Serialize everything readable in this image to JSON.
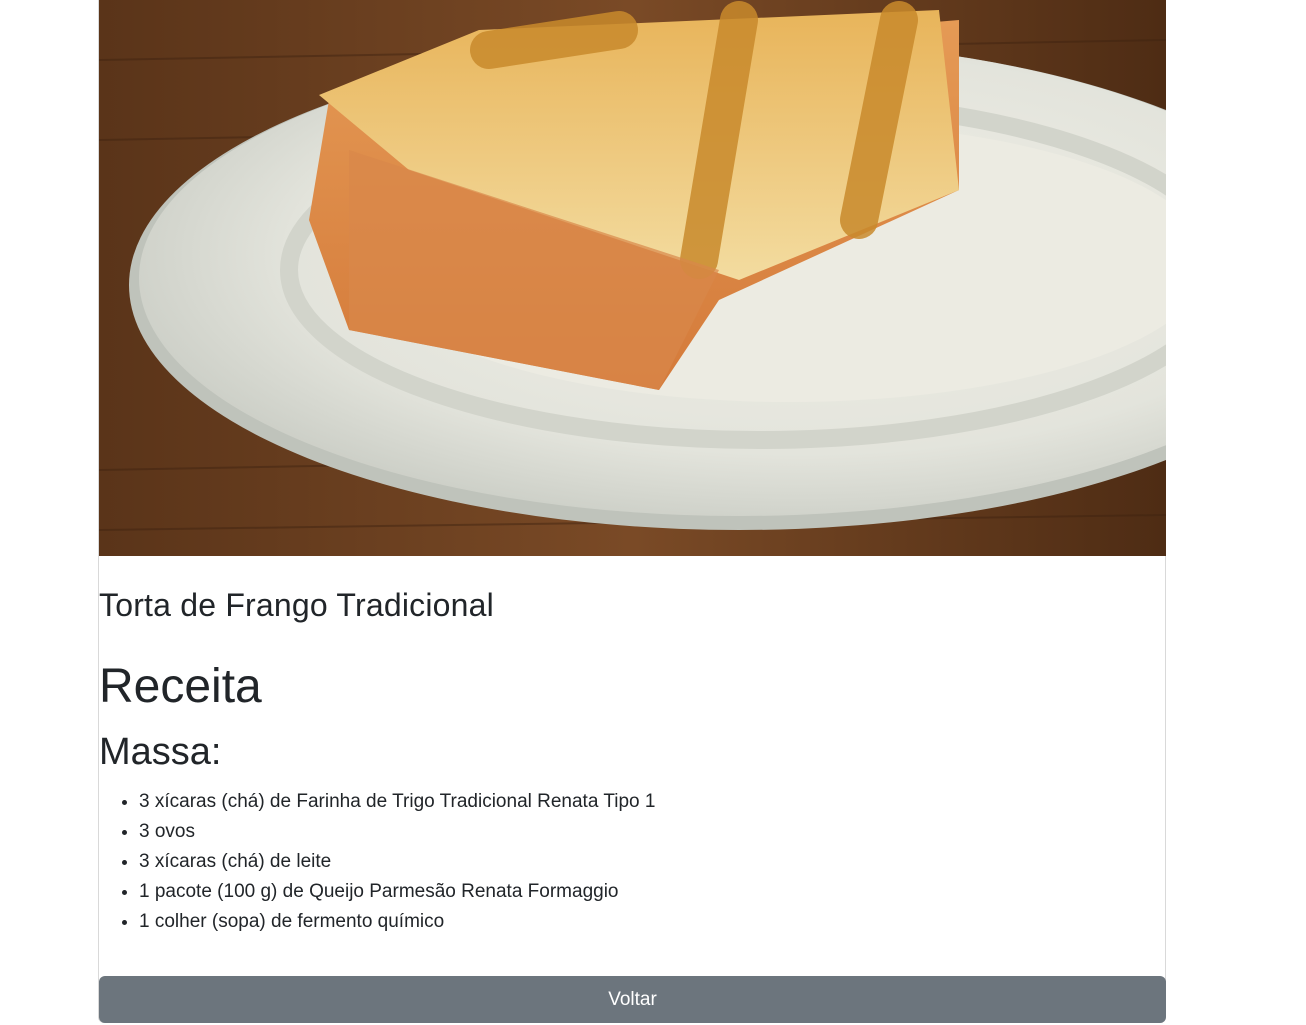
{
  "recipe": {
    "image_alt": "Torta de Frango Tradicional",
    "title": "Torta de Frango Tradicional",
    "section_heading": "Receita",
    "subsection_heading": "Massa:",
    "ingredients": [
      "3 xícaras (chá) de Farinha de Trigo Tradicional Renata Tipo 1",
      "3 ovos",
      "3 xícaras (chá) de leite",
      "1 pacote (100 g) de Queijo Parmesão Renata Formaggio",
      "1 colher (sopa) de fermento químico"
    ]
  },
  "actions": {
    "back_label": "Voltar"
  },
  "colors": {
    "button_bg": "#6c757d",
    "text": "#212529"
  }
}
